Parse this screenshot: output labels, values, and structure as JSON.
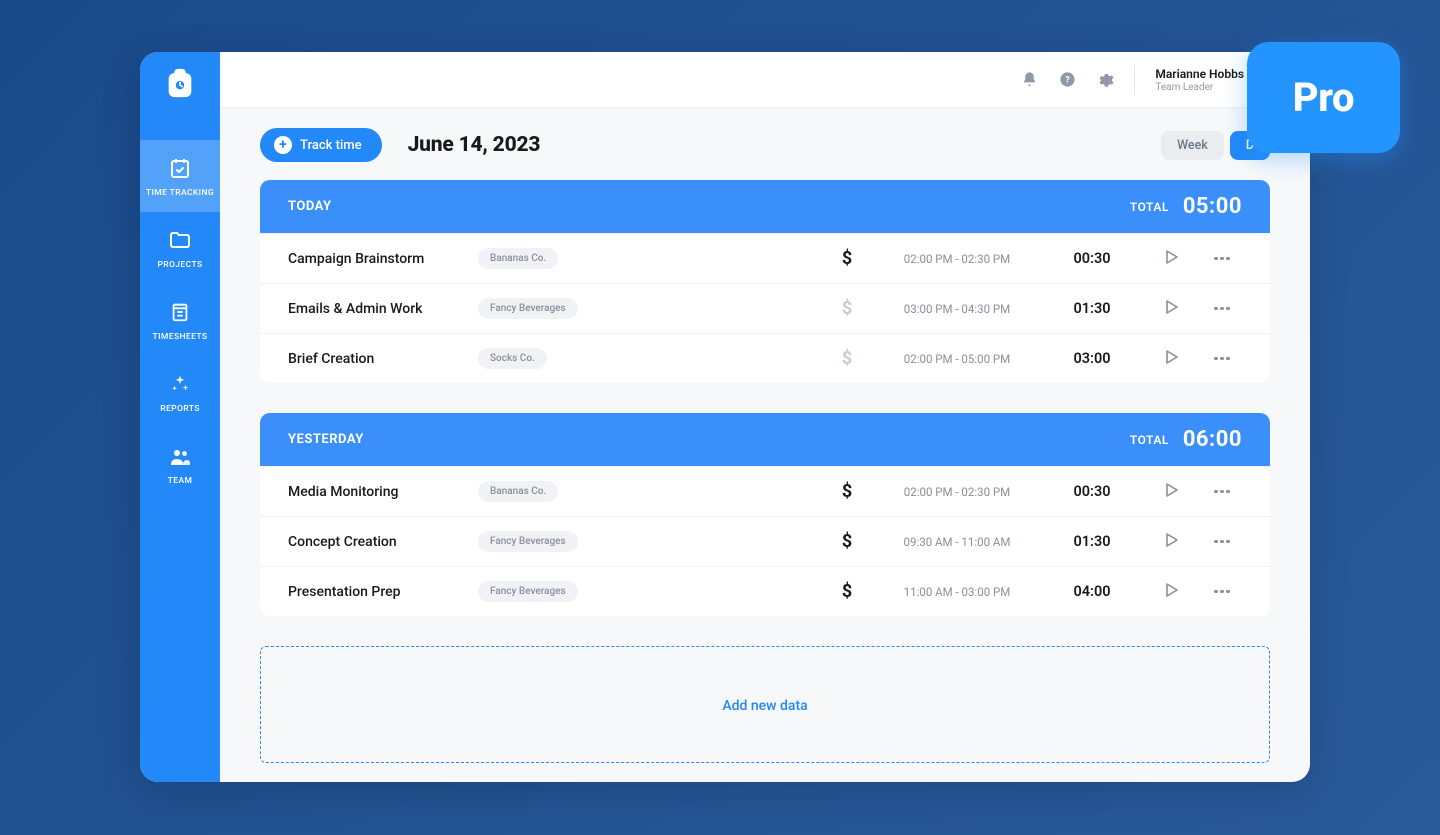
{
  "badge": "Pro",
  "header": {
    "user_name": "Marianne Hobbs",
    "user_role": "Team Leader"
  },
  "sidebar": {
    "items": [
      {
        "label": "TIME TRACKING"
      },
      {
        "label": "PROJECTS"
      },
      {
        "label": "TIMESHEETS"
      },
      {
        "label": "REPORTS"
      },
      {
        "label": "TEAM"
      }
    ]
  },
  "controls": {
    "track_label": "Track time",
    "date_title": "June 14, 2023",
    "toggle_week": "Week",
    "toggle_day": "D"
  },
  "sections": [
    {
      "title": "TODAY",
      "total_label": "TOTAL",
      "total_value": "05:00",
      "rows": [
        {
          "task": "Campaign Brainstorm",
          "tag": "Bananas Co.",
          "billable": true,
          "range": "02:00 PM - 02:30 PM",
          "duration": "00:30"
        },
        {
          "task": "Emails & Admin Work",
          "tag": "Fancy Beverages",
          "billable": false,
          "range": "03:00 PM - 04:30 PM",
          "duration": "01:30"
        },
        {
          "task": "Brief Creation",
          "tag": "Socks Co.",
          "billable": false,
          "range": "02:00 PM - 05:00 PM",
          "duration": "03:00"
        }
      ]
    },
    {
      "title": "YESTERDAY",
      "total_label": "TOTAL",
      "total_value": "06:00",
      "rows": [
        {
          "task": "Media Monitoring",
          "tag": "Bananas Co.",
          "billable": true,
          "range": "02:00 PM - 02:30 PM",
          "duration": "00:30"
        },
        {
          "task": "Concept Creation",
          "tag": "Fancy Beverages",
          "billable": true,
          "range": "09:30 AM - 11:00 AM",
          "duration": "01:30"
        },
        {
          "task": "Presentation Prep",
          "tag": "Fancy Beverages",
          "billable": true,
          "range": "11:00 AM - 03:00 PM",
          "duration": "04:00"
        }
      ]
    }
  ],
  "add_new_label": "Add new data"
}
